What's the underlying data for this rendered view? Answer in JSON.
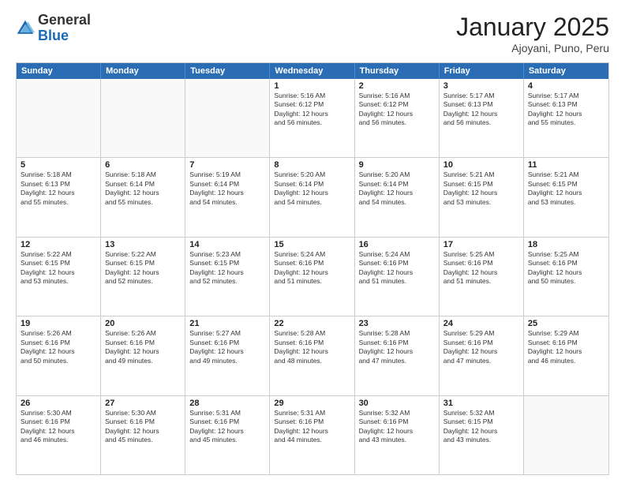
{
  "header": {
    "logo_general": "General",
    "logo_blue": "Blue",
    "month_title": "January 2025",
    "location": "Ajoyani, Puno, Peru"
  },
  "weekdays": [
    "Sunday",
    "Monday",
    "Tuesday",
    "Wednesday",
    "Thursday",
    "Friday",
    "Saturday"
  ],
  "rows": [
    [
      {
        "day": "",
        "info": ""
      },
      {
        "day": "",
        "info": ""
      },
      {
        "day": "",
        "info": ""
      },
      {
        "day": "1",
        "info": "Sunrise: 5:16 AM\nSunset: 6:12 PM\nDaylight: 12 hours\nand 56 minutes."
      },
      {
        "day": "2",
        "info": "Sunrise: 5:16 AM\nSunset: 6:12 PM\nDaylight: 12 hours\nand 56 minutes."
      },
      {
        "day": "3",
        "info": "Sunrise: 5:17 AM\nSunset: 6:13 PM\nDaylight: 12 hours\nand 56 minutes."
      },
      {
        "day": "4",
        "info": "Sunrise: 5:17 AM\nSunset: 6:13 PM\nDaylight: 12 hours\nand 55 minutes."
      }
    ],
    [
      {
        "day": "5",
        "info": "Sunrise: 5:18 AM\nSunset: 6:13 PM\nDaylight: 12 hours\nand 55 minutes."
      },
      {
        "day": "6",
        "info": "Sunrise: 5:18 AM\nSunset: 6:14 PM\nDaylight: 12 hours\nand 55 minutes."
      },
      {
        "day": "7",
        "info": "Sunrise: 5:19 AM\nSunset: 6:14 PM\nDaylight: 12 hours\nand 54 minutes."
      },
      {
        "day": "8",
        "info": "Sunrise: 5:20 AM\nSunset: 6:14 PM\nDaylight: 12 hours\nand 54 minutes."
      },
      {
        "day": "9",
        "info": "Sunrise: 5:20 AM\nSunset: 6:14 PM\nDaylight: 12 hours\nand 54 minutes."
      },
      {
        "day": "10",
        "info": "Sunrise: 5:21 AM\nSunset: 6:15 PM\nDaylight: 12 hours\nand 53 minutes."
      },
      {
        "day": "11",
        "info": "Sunrise: 5:21 AM\nSunset: 6:15 PM\nDaylight: 12 hours\nand 53 minutes."
      }
    ],
    [
      {
        "day": "12",
        "info": "Sunrise: 5:22 AM\nSunset: 6:15 PM\nDaylight: 12 hours\nand 53 minutes."
      },
      {
        "day": "13",
        "info": "Sunrise: 5:22 AM\nSunset: 6:15 PM\nDaylight: 12 hours\nand 52 minutes."
      },
      {
        "day": "14",
        "info": "Sunrise: 5:23 AM\nSunset: 6:15 PM\nDaylight: 12 hours\nand 52 minutes."
      },
      {
        "day": "15",
        "info": "Sunrise: 5:24 AM\nSunset: 6:16 PM\nDaylight: 12 hours\nand 51 minutes."
      },
      {
        "day": "16",
        "info": "Sunrise: 5:24 AM\nSunset: 6:16 PM\nDaylight: 12 hours\nand 51 minutes."
      },
      {
        "day": "17",
        "info": "Sunrise: 5:25 AM\nSunset: 6:16 PM\nDaylight: 12 hours\nand 51 minutes."
      },
      {
        "day": "18",
        "info": "Sunrise: 5:25 AM\nSunset: 6:16 PM\nDaylight: 12 hours\nand 50 minutes."
      }
    ],
    [
      {
        "day": "19",
        "info": "Sunrise: 5:26 AM\nSunset: 6:16 PM\nDaylight: 12 hours\nand 50 minutes."
      },
      {
        "day": "20",
        "info": "Sunrise: 5:26 AM\nSunset: 6:16 PM\nDaylight: 12 hours\nand 49 minutes."
      },
      {
        "day": "21",
        "info": "Sunrise: 5:27 AM\nSunset: 6:16 PM\nDaylight: 12 hours\nand 49 minutes."
      },
      {
        "day": "22",
        "info": "Sunrise: 5:28 AM\nSunset: 6:16 PM\nDaylight: 12 hours\nand 48 minutes."
      },
      {
        "day": "23",
        "info": "Sunrise: 5:28 AM\nSunset: 6:16 PM\nDaylight: 12 hours\nand 47 minutes."
      },
      {
        "day": "24",
        "info": "Sunrise: 5:29 AM\nSunset: 6:16 PM\nDaylight: 12 hours\nand 47 minutes."
      },
      {
        "day": "25",
        "info": "Sunrise: 5:29 AM\nSunset: 6:16 PM\nDaylight: 12 hours\nand 46 minutes."
      }
    ],
    [
      {
        "day": "26",
        "info": "Sunrise: 5:30 AM\nSunset: 6:16 PM\nDaylight: 12 hours\nand 46 minutes."
      },
      {
        "day": "27",
        "info": "Sunrise: 5:30 AM\nSunset: 6:16 PM\nDaylight: 12 hours\nand 45 minutes."
      },
      {
        "day": "28",
        "info": "Sunrise: 5:31 AM\nSunset: 6:16 PM\nDaylight: 12 hours\nand 45 minutes."
      },
      {
        "day": "29",
        "info": "Sunrise: 5:31 AM\nSunset: 6:16 PM\nDaylight: 12 hours\nand 44 minutes."
      },
      {
        "day": "30",
        "info": "Sunrise: 5:32 AM\nSunset: 6:16 PM\nDaylight: 12 hours\nand 43 minutes."
      },
      {
        "day": "31",
        "info": "Sunrise: 5:32 AM\nSunset: 6:15 PM\nDaylight: 12 hours\nand 43 minutes."
      },
      {
        "day": "",
        "info": ""
      }
    ]
  ]
}
